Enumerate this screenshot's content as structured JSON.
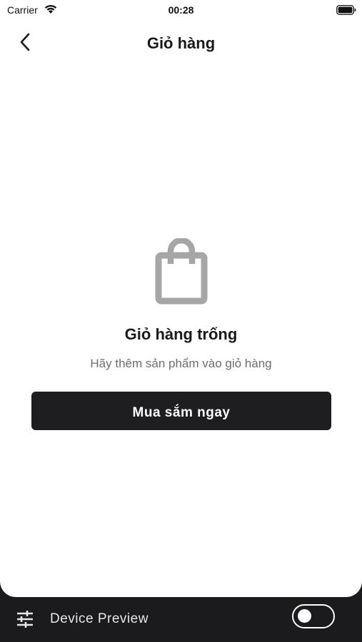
{
  "status_bar": {
    "carrier": "Carrier",
    "time": "00:28",
    "icons": [
      "wifi-icon",
      "battery-icon"
    ]
  },
  "header": {
    "title": "Giỏ hàng",
    "back_icon": "chevron-left-icon"
  },
  "empty_state": {
    "icon": "shopping-bag-icon",
    "title": "Giỏ hàng trống",
    "subtitle": "Hãy thêm sản phẩm vào giỏ hàng",
    "button_label": "Mua sắm ngay"
  },
  "device_preview": {
    "icon": "sliders-icon",
    "label": "Device Preview",
    "toggle_on": false
  },
  "colors": {
    "button_bg": "#1e1e20",
    "icon_gray": "#a6a6a6",
    "subtitle_gray": "#6e6e6e",
    "preview_bar_bg": "#1b1b1d"
  }
}
